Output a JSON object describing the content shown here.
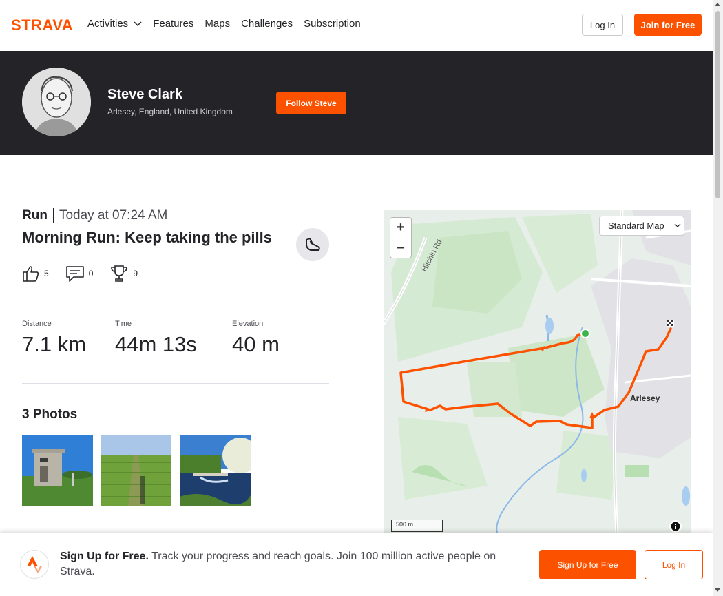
{
  "nav": {
    "brand": "STRAVA",
    "items": [
      {
        "label": "Activities",
        "has_dropdown": true
      },
      {
        "label": "Features"
      },
      {
        "label": "Maps"
      },
      {
        "label": "Challenges"
      },
      {
        "label": "Subscription"
      }
    ],
    "login_label": "Log In",
    "join_label": "Join for Free"
  },
  "athlete": {
    "name": "Steve Clark",
    "location": "Arlesey, England, United Kingdom",
    "follow_label": "Follow Steve"
  },
  "activity": {
    "type": "Run",
    "date": "Today at 07:24 AM",
    "title": "Morning Run: Keep taking the pills",
    "kudos": "5",
    "comments": "0",
    "achievements": "9",
    "stats": [
      {
        "label": "Distance",
        "value": "7.1 km"
      },
      {
        "label": "Time",
        "value": "44m 13s"
      },
      {
        "label": "Elevation",
        "value": "40 m"
      }
    ],
    "photos_title": "3 Photos"
  },
  "map": {
    "type_label": "Standard Map",
    "zoom_in": "+",
    "zoom_out": "−",
    "scale_label": "500 m",
    "labels": {
      "road": "Hitchin Rd",
      "town": "Arlesey"
    },
    "route_color": "#fc5200",
    "start_color": "#3cb44b"
  },
  "signup_bar": {
    "headline": "Sign Up for Free.",
    "body": " Track your progress and reach goals. Join 100 million active people on Strava.",
    "signup_label": "Sign Up for Free",
    "login_label": "Log In"
  },
  "colors": {
    "brand": "#fc5200",
    "banner": "#242428"
  }
}
